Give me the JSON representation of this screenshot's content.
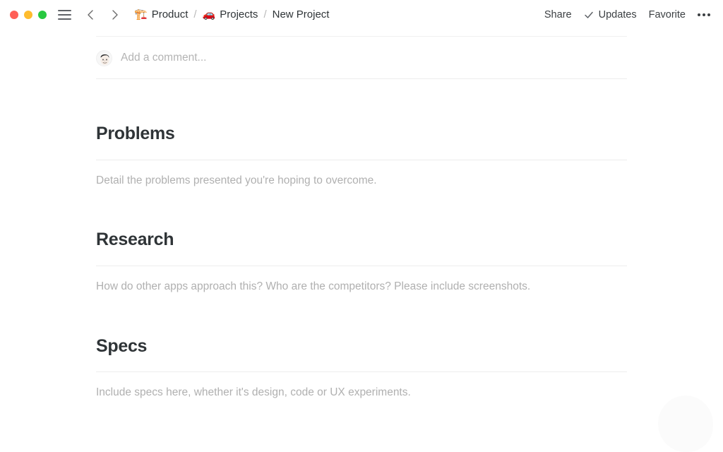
{
  "window": {
    "traffic_lights": [
      {
        "name": "close",
        "color": "#FF5F57"
      },
      {
        "name": "minimize",
        "color": "#FEBC2E"
      },
      {
        "name": "zoom",
        "color": "#28C840"
      }
    ],
    "menu_icon": "hamburger-icon",
    "back_icon": "arrow-left-icon",
    "forward_icon": "arrow-right-icon"
  },
  "breadcrumb": {
    "separator": "/",
    "items": [
      {
        "emoji": "🏗️",
        "icon_name": "construction-crane-emoji",
        "label": "Product"
      },
      {
        "emoji": "🚗",
        "icon_name": "red-car-emoji",
        "label": "Projects"
      },
      {
        "emoji": "",
        "icon_name": "",
        "label": "New Project"
      }
    ]
  },
  "header_actions": {
    "share_label": "Share",
    "updates_label": "Updates",
    "updates_icon": "check-icon",
    "favorite_label": "Favorite",
    "more_icon": "ellipsis-icon"
  },
  "comment": {
    "avatar_name": "user-avatar",
    "placeholder": "Add a comment..."
  },
  "clipped_top_text": "· · ··",
  "sections": [
    {
      "heading": "Problems",
      "description": "Detail the problems presented you're hoping to overcome."
    },
    {
      "heading": "Research",
      "description": "How do other apps approach this? Who are the competitors? Please include screenshots."
    },
    {
      "heading": "Specs",
      "description": "Include specs here, whether it's design, code or UX experiments."
    }
  ],
  "colors": {
    "text_primary": "#2f3437",
    "text_muted": "#b0b0b0",
    "divider": "#ededed",
    "background": "#ffffff"
  }
}
